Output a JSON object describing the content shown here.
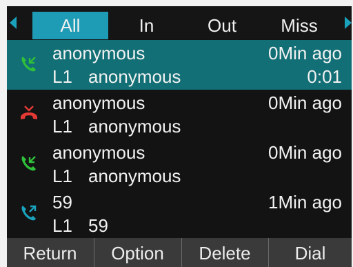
{
  "tabs": [
    {
      "label": "All",
      "active": true
    },
    {
      "label": "In",
      "active": false
    },
    {
      "label": "Out",
      "active": false
    },
    {
      "label": "Miss",
      "active": false
    }
  ],
  "calls": [
    {
      "name": "anonymous",
      "time": "0Min ago",
      "line": "L1",
      "number": "anonymous",
      "duration": "0:01",
      "type": "incoming",
      "icon": "phone-incoming-icon",
      "selected": true
    },
    {
      "name": "anonymous",
      "time": "0Min ago",
      "line": "L1",
      "number": "anonymous",
      "duration": "",
      "type": "missed",
      "icon": "phone-missed-icon",
      "selected": false
    },
    {
      "name": "anonymous",
      "time": "0Min ago",
      "line": "L1",
      "number": "anonymous",
      "duration": "",
      "type": "incoming",
      "icon": "phone-incoming-icon",
      "selected": false
    },
    {
      "name": "59",
      "time": "1Min ago",
      "line": "L1",
      "number": "59",
      "duration": "",
      "type": "outgoing",
      "icon": "phone-outgoing-icon",
      "selected": false
    }
  ],
  "softkeys": [
    "Return",
    "Option",
    "Delete",
    "Dial"
  ],
  "colors": {
    "accent": "#1f9cb5",
    "selected_row": "#126f75",
    "incoming": "#2fbf3a",
    "missed": "#e53935",
    "outgoing": "#1aa2bd",
    "softkey_bar": "#3a3a3a"
  }
}
